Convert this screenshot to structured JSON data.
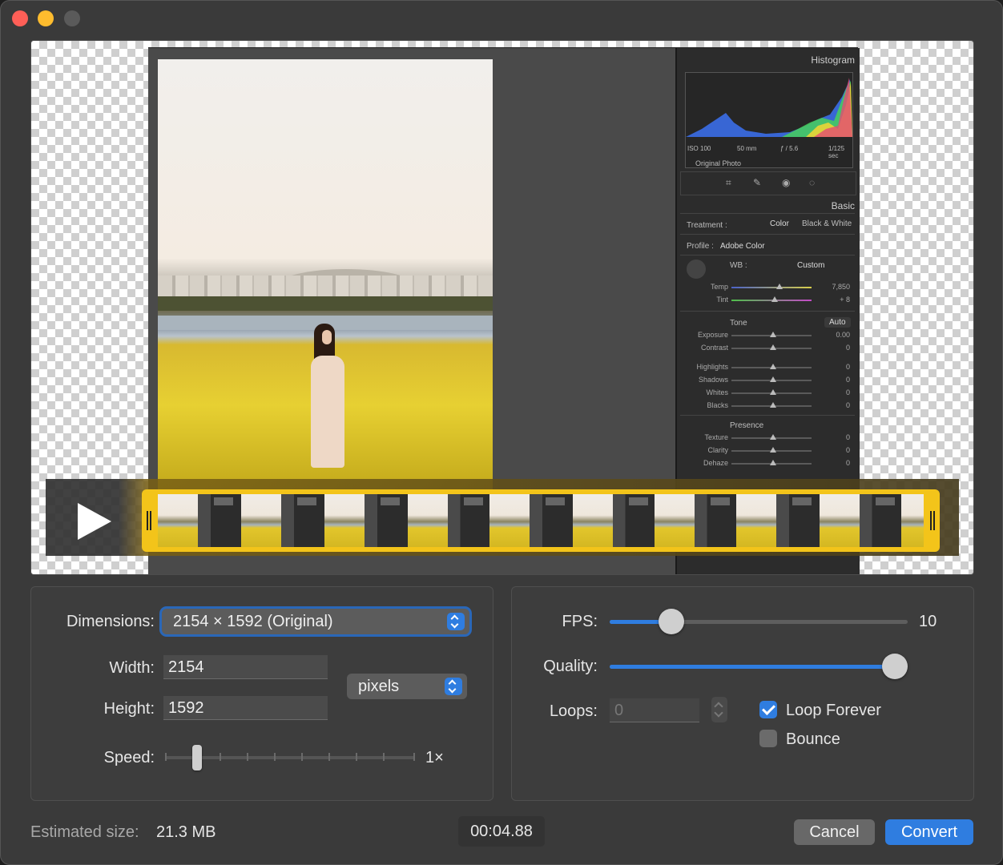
{
  "window": {
    "controls": [
      "close",
      "minimize",
      "zoom"
    ]
  },
  "preview": {
    "lightroom": {
      "histogram_header": "Histogram",
      "histogram_info": [
        "ISO 100",
        "50 mm",
        "ƒ / 5.6",
        "1/125 sec"
      ],
      "original_photo": "Original Photo",
      "basic_header": "Basic",
      "treatment_label": "Treatment :",
      "treatment_color": "Color",
      "treatment_bw": "Black & White",
      "profile_label": "Profile :",
      "profile_value": "Adobe Color",
      "wb_label": "WB :",
      "wb_value": "Custom",
      "temp": {
        "label": "Temp",
        "value": "7,850"
      },
      "tint": {
        "label": "Tint",
        "value": "+ 8"
      },
      "tone_label": "Tone",
      "auto_label": "Auto",
      "exposure": {
        "label": "Exposure",
        "value": "0.00"
      },
      "contrast": {
        "label": "Contrast",
        "value": "0"
      },
      "highlights": {
        "label": "Highlights",
        "value": "0"
      },
      "shadows": {
        "label": "Shadows",
        "value": "0"
      },
      "whites": {
        "label": "Whites",
        "value": "0"
      },
      "blacks": {
        "label": "Blacks",
        "value": "0"
      },
      "presence_label": "Presence",
      "texture": {
        "label": "Texture",
        "value": "0"
      },
      "clarity": {
        "label": "Clarity",
        "value": "0"
      },
      "dehaze": {
        "label": "Dehaze",
        "value": "0"
      }
    },
    "play_icon": "play-icon"
  },
  "settings": {
    "dimensions_label": "Dimensions:",
    "dimensions_value": "2154 × 1592 (Original)",
    "width_label": "Width:",
    "width_value": "2154",
    "height_label": "Height:",
    "height_value": "1592",
    "units_value": "pixels",
    "speed_label": "Speed:",
    "speed_value": "1×",
    "fps_label": "FPS:",
    "fps_value": "10",
    "fps_fraction": 0.18,
    "quality_label": "Quality:",
    "quality_fraction": 1.0,
    "loops_label": "Loops:",
    "loops_placeholder": "0",
    "loop_forever_label": "Loop Forever",
    "loop_forever_checked": true,
    "bounce_label": "Bounce",
    "bounce_checked": false
  },
  "footer": {
    "estimated_label": "Estimated size:",
    "estimated_value": "21.3 MB",
    "timecode": "00:04.88",
    "cancel_label": "Cancel",
    "convert_label": "Convert"
  },
  "colors": {
    "accent": "#2f7de0",
    "trim": "#f3c41a",
    "close": "#ff5f57",
    "minimize": "#febc2e"
  }
}
